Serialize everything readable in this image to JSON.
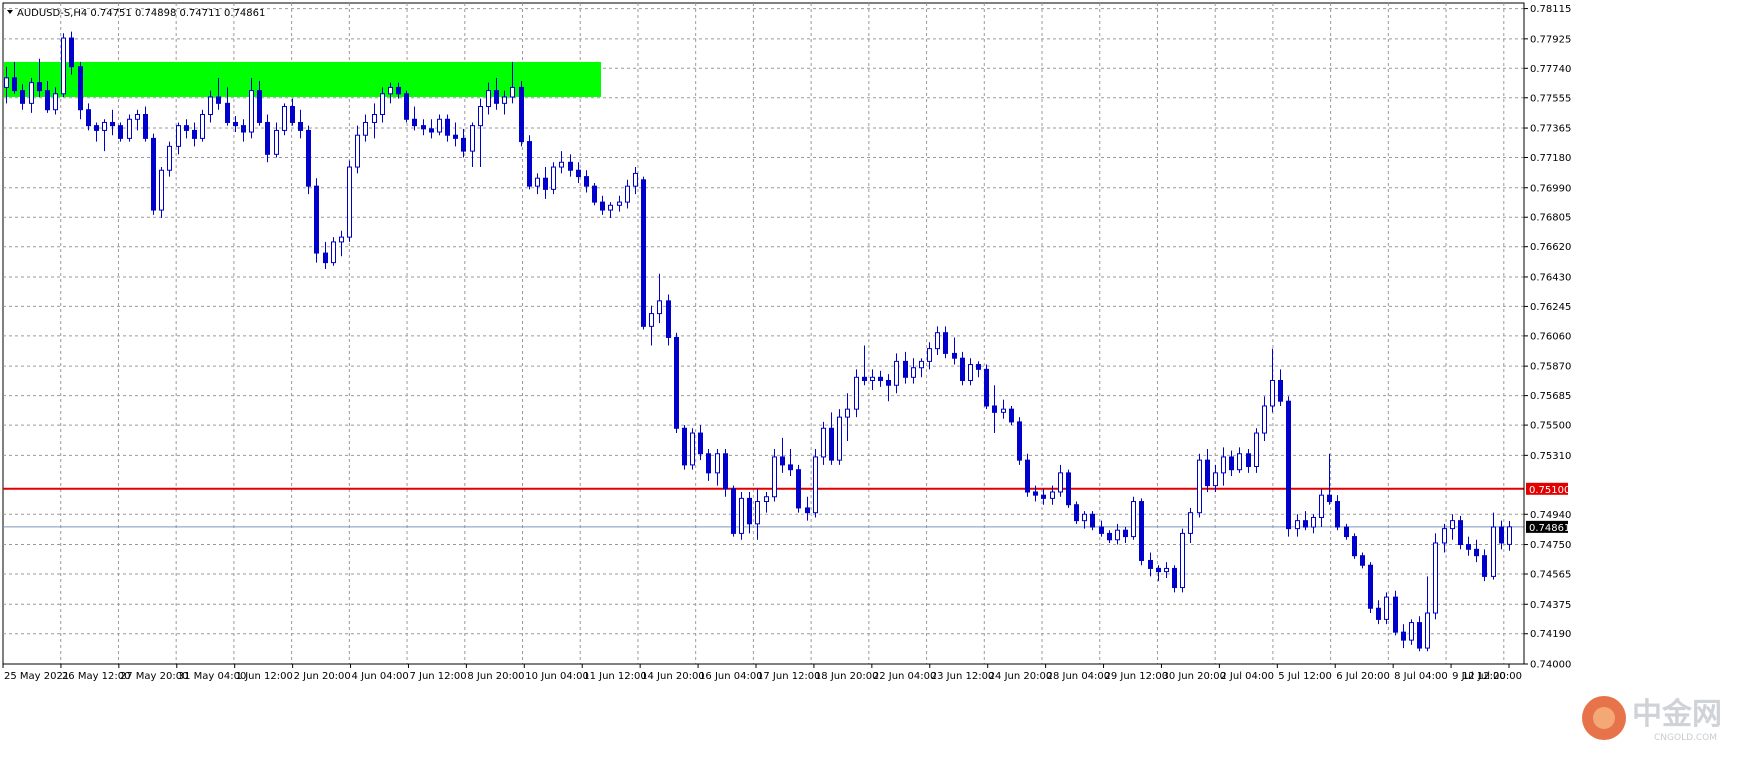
{
  "header": {
    "symbol_text": "AUDUSD-S,H4  0.74751 0.74898 0.74711 0.74861"
  },
  "watermark": {
    "brand_cn": "中金网",
    "brand_en": "CNGOLD.COM"
  },
  "colors": {
    "bull": "#ffffff",
    "bear": "#0000cc",
    "outline": "#0000cc",
    "grid": "#9a9a9a",
    "zone": "#00ff00",
    "resistance_line": "#e00000",
    "current_price_line": "#7a96b8",
    "label_bg": "#000000",
    "label_fg": "#ffffff"
  },
  "chart_data": {
    "type": "candlestick",
    "symbol": "AUDUSD-S",
    "timeframe": "H4",
    "last_bar": {
      "open": 0.74751,
      "high": 0.74898,
      "low": 0.74711,
      "close": 0.74861
    },
    "ylim": [
      0.74,
      0.7815
    ],
    "y_ticks": [
      0.78115,
      0.77925,
      0.7774,
      0.77555,
      0.77365,
      0.7718,
      0.7699,
      0.76805,
      0.7662,
      0.7643,
      0.76245,
      0.7606,
      0.7587,
      0.75685,
      0.755,
      0.7531,
      0.7494,
      0.7475,
      0.74565,
      0.74375,
      0.7419,
      0.74
    ],
    "y_tick_labels": [
      "0.78115",
      "0.77925",
      "0.77740",
      "0.77555",
      "0.77365",
      "0.77180",
      "0.76990",
      "0.76805",
      "0.76620",
      "0.76430",
      "0.76245",
      "0.76060",
      "0.75870",
      "0.75685",
      "0.75500",
      "0.75310",
      "0.74940",
      "0.74750",
      "0.74565",
      "0.74375",
      "0.74190",
      "0.74000"
    ],
    "x_labels": [
      "25 May 2021",
      "26 May 12:00",
      "27 May 20:00",
      "31 May 04:00",
      "1 Jun 12:00",
      "2 Jun 20:00",
      "4 Jun 04:00",
      "7 Jun 12:00",
      "8 Jun 20:00",
      "10 Jun 04:00",
      "11 Jun 12:00",
      "14 Jun 20:00",
      "16 Jun 04:00",
      "17 Jun 12:00",
      "18 Jun 20:00",
      "22 Jun 04:00",
      "23 Jun 12:00",
      "24 Jun 20:00",
      "28 Jun 04:00",
      "29 Jun 12:00",
      "30 Jun 20:00",
      "2 Jul 04:00",
      "5 Jul 12:00",
      "6 Jul 20:00",
      "8 Jul 04:00",
      "9 Jul 12:00",
      "12 Jul 20:00"
    ],
    "resistance_level": {
      "price": 0.751,
      "label": "0.75100"
    },
    "current_price": {
      "price": 0.74861,
      "label": "0.74861"
    },
    "supply_zone": {
      "price_top": 0.7778,
      "price_bottom": 0.7756
    },
    "grid": true,
    "candles": [
      [
        0.7762,
        0.7775,
        0.7752,
        0.7768
      ],
      [
        0.7768,
        0.7778,
        0.7758,
        0.776
      ],
      [
        0.776,
        0.7764,
        0.7748,
        0.7752
      ],
      [
        0.7752,
        0.7768,
        0.7746,
        0.7765
      ],
      [
        0.7765,
        0.778,
        0.7756,
        0.776
      ],
      [
        0.776,
        0.7766,
        0.7746,
        0.7748
      ],
      [
        0.7748,
        0.7762,
        0.7745,
        0.7758
      ],
      [
        0.7758,
        0.7796,
        0.7756,
        0.7793
      ],
      [
        0.7793,
        0.7797,
        0.777,
        0.7775
      ],
      [
        0.7775,
        0.7778,
        0.7742,
        0.7748
      ],
      [
        0.7748,
        0.7752,
        0.7735,
        0.7738
      ],
      [
        0.7738,
        0.774,
        0.7728,
        0.7735
      ],
      [
        0.7735,
        0.7742,
        0.7722,
        0.774
      ],
      [
        0.774,
        0.7748,
        0.7732,
        0.7738
      ],
      [
        0.7738,
        0.774,
        0.7728,
        0.773
      ],
      [
        0.773,
        0.7745,
        0.7728,
        0.7742
      ],
      [
        0.7742,
        0.7748,
        0.7735,
        0.7745
      ],
      [
        0.7745,
        0.775,
        0.7728,
        0.773
      ],
      [
        0.773,
        0.7733,
        0.7682,
        0.7685
      ],
      [
        0.7685,
        0.7712,
        0.768,
        0.771
      ],
      [
        0.771,
        0.7728,
        0.7706,
        0.7725
      ],
      [
        0.7725,
        0.774,
        0.772,
        0.7738
      ],
      [
        0.7738,
        0.7742,
        0.773,
        0.7735
      ],
      [
        0.7735,
        0.774,
        0.7725,
        0.773
      ],
      [
        0.773,
        0.7748,
        0.7728,
        0.7745
      ],
      [
        0.7745,
        0.776,
        0.774,
        0.7756
      ],
      [
        0.7756,
        0.7768,
        0.7748,
        0.7752
      ],
      [
        0.7752,
        0.7762,
        0.7738,
        0.774
      ],
      [
        0.774,
        0.7744,
        0.7734,
        0.7738
      ],
      [
        0.7738,
        0.7742,
        0.7728,
        0.7734
      ],
      [
        0.7734,
        0.7768,
        0.773,
        0.776
      ],
      [
        0.776,
        0.7766,
        0.7738,
        0.774
      ],
      [
        0.774,
        0.7745,
        0.7715,
        0.772
      ],
      [
        0.772,
        0.774,
        0.7718,
        0.7735
      ],
      [
        0.7735,
        0.7752,
        0.7732,
        0.775
      ],
      [
        0.775,
        0.7755,
        0.7738,
        0.774
      ],
      [
        0.774,
        0.7748,
        0.773,
        0.7735
      ],
      [
        0.7735,
        0.7738,
        0.7695,
        0.77
      ],
      [
        0.77,
        0.7705,
        0.7652,
        0.7658
      ],
      [
        0.7658,
        0.7665,
        0.7648,
        0.7652
      ],
      [
        0.7652,
        0.7668,
        0.765,
        0.7665
      ],
      [
        0.7665,
        0.7672,
        0.7656,
        0.7668
      ],
      [
        0.7668,
        0.7716,
        0.7665,
        0.7712
      ],
      [
        0.7712,
        0.7738,
        0.7708,
        0.7732
      ],
      [
        0.7732,
        0.7745,
        0.7728,
        0.774
      ],
      [
        0.774,
        0.7752,
        0.773,
        0.7745
      ],
      [
        0.7745,
        0.7762,
        0.774,
        0.7758
      ],
      [
        0.7758,
        0.7765,
        0.7752,
        0.7762
      ],
      [
        0.7762,
        0.7765,
        0.7755,
        0.7758
      ],
      [
        0.7758,
        0.776,
        0.774,
        0.7742
      ],
      [
        0.7742,
        0.775,
        0.7735,
        0.7738
      ],
      [
        0.7738,
        0.7742,
        0.7732,
        0.7736
      ],
      [
        0.7736,
        0.7742,
        0.773,
        0.7734
      ],
      [
        0.7734,
        0.7745,
        0.7732,
        0.7742
      ],
      [
        0.7742,
        0.7745,
        0.7728,
        0.7732
      ],
      [
        0.7732,
        0.774,
        0.7725,
        0.773
      ],
      [
        0.773,
        0.7736,
        0.7718,
        0.7722
      ],
      [
        0.7722,
        0.774,
        0.7712,
        0.7738
      ],
      [
        0.7738,
        0.7755,
        0.7712,
        0.775
      ],
      [
        0.775,
        0.7765,
        0.7745,
        0.776
      ],
      [
        0.776,
        0.7768,
        0.7748,
        0.7752
      ],
      [
        0.7752,
        0.776,
        0.7745,
        0.7756
      ],
      [
        0.7756,
        0.7778,
        0.7752,
        0.7762
      ],
      [
        0.7762,
        0.7766,
        0.7725,
        0.7728
      ],
      [
        0.7728,
        0.7732,
        0.7698,
        0.77
      ],
      [
        0.77,
        0.7708,
        0.7695,
        0.7705
      ],
      [
        0.7705,
        0.7712,
        0.7692,
        0.7698
      ],
      [
        0.7698,
        0.7715,
        0.7695,
        0.7712
      ],
      [
        0.7712,
        0.7722,
        0.7708,
        0.7715
      ],
      [
        0.7715,
        0.772,
        0.7706,
        0.771
      ],
      [
        0.771,
        0.7715,
        0.7702,
        0.7706
      ],
      [
        0.7706,
        0.771,
        0.7696,
        0.77
      ],
      [
        0.77,
        0.7702,
        0.7688,
        0.769
      ],
      [
        0.769,
        0.7694,
        0.7682,
        0.7685
      ],
      [
        0.7685,
        0.769,
        0.768,
        0.7688
      ],
      [
        0.7688,
        0.7694,
        0.7684,
        0.769
      ],
      [
        0.769,
        0.7704,
        0.7686,
        0.77
      ],
      [
        0.77,
        0.7712,
        0.7695,
        0.7708
      ],
      [
        0.7704,
        0.7706,
        0.761,
        0.7612
      ],
      [
        0.7612,
        0.7625,
        0.76,
        0.762
      ],
      [
        0.762,
        0.7645,
        0.7614,
        0.7628
      ],
      [
        0.7628,
        0.7632,
        0.76,
        0.7605
      ],
      [
        0.7605,
        0.7608,
        0.7545,
        0.7548
      ],
      [
        0.7548,
        0.755,
        0.7522,
        0.7525
      ],
      [
        0.7525,
        0.7548,
        0.7522,
        0.7545
      ],
      [
        0.7545,
        0.755,
        0.7528,
        0.7532
      ],
      [
        0.7532,
        0.7535,
        0.7515,
        0.752
      ],
      [
        0.752,
        0.7535,
        0.7512,
        0.7532
      ],
      [
        0.7532,
        0.7535,
        0.7505,
        0.751
      ],
      [
        0.751,
        0.7512,
        0.748,
        0.7482
      ],
      [
        0.7482,
        0.7508,
        0.7478,
        0.7504
      ],
      [
        0.7504,
        0.7508,
        0.7482,
        0.7488
      ],
      [
        0.7488,
        0.751,
        0.7478,
        0.7502
      ],
      [
        0.7502,
        0.7508,
        0.7495,
        0.7505
      ],
      [
        0.7505,
        0.7535,
        0.7502,
        0.753
      ],
      [
        0.753,
        0.7542,
        0.752,
        0.7525
      ],
      [
        0.7525,
        0.7535,
        0.7518,
        0.7522
      ],
      [
        0.7522,
        0.7525,
        0.7495,
        0.7498
      ],
      [
        0.7498,
        0.7505,
        0.749,
        0.7495
      ],
      [
        0.7495,
        0.7535,
        0.7492,
        0.753
      ],
      [
        0.753,
        0.7552,
        0.7525,
        0.7548
      ],
      [
        0.7548,
        0.7558,
        0.7525,
        0.7528
      ],
      [
        0.7528,
        0.756,
        0.7525,
        0.7555
      ],
      [
        0.7555,
        0.757,
        0.754,
        0.756
      ],
      [
        0.756,
        0.7585,
        0.7555,
        0.758
      ],
      [
        0.758,
        0.76,
        0.7575,
        0.7578
      ],
      [
        0.7578,
        0.7585,
        0.7572,
        0.758
      ],
      [
        0.758,
        0.7584,
        0.7574,
        0.7578
      ],
      [
        0.7578,
        0.7582,
        0.7565,
        0.7575
      ],
      [
        0.7575,
        0.7595,
        0.757,
        0.759
      ],
      [
        0.759,
        0.7596,
        0.7576,
        0.758
      ],
      [
        0.758,
        0.7592,
        0.7576,
        0.7586
      ],
      [
        0.7586,
        0.7592,
        0.758,
        0.759
      ],
      [
        0.759,
        0.7602,
        0.7585,
        0.7598
      ],
      [
        0.7598,
        0.7612,
        0.7594,
        0.7608
      ],
      [
        0.7608,
        0.7612,
        0.7592,
        0.7595
      ],
      [
        0.7595,
        0.7605,
        0.7588,
        0.7592
      ],
      [
        0.7592,
        0.7596,
        0.7575,
        0.7578
      ],
      [
        0.7578,
        0.7592,
        0.7575,
        0.7588
      ],
      [
        0.7588,
        0.759,
        0.758,
        0.7585
      ],
      [
        0.7585,
        0.7588,
        0.756,
        0.7562
      ],
      [
        0.7562,
        0.7575,
        0.7545,
        0.7558
      ],
      [
        0.7558,
        0.7566,
        0.7554,
        0.756
      ],
      [
        0.756,
        0.7562,
        0.755,
        0.7552
      ],
      [
        0.7552,
        0.7555,
        0.7525,
        0.7528
      ],
      [
        0.7528,
        0.7532,
        0.7505,
        0.7508
      ],
      [
        0.7508,
        0.7512,
        0.7502,
        0.7506
      ],
      [
        0.7506,
        0.751,
        0.75,
        0.7504
      ],
      [
        0.7504,
        0.7512,
        0.75,
        0.7508
      ],
      [
        0.7508,
        0.7525,
        0.7505,
        0.752
      ],
      [
        0.752,
        0.7522,
        0.7498,
        0.75
      ],
      [
        0.75,
        0.7502,
        0.7488,
        0.749
      ],
      [
        0.749,
        0.7496,
        0.7485,
        0.7494
      ],
      [
        0.7494,
        0.7496,
        0.7484,
        0.7486
      ],
      [
        0.7486,
        0.749,
        0.748,
        0.7482
      ],
      [
        0.7482,
        0.7484,
        0.7476,
        0.7478
      ],
      [
        0.7478,
        0.7488,
        0.7475,
        0.7484
      ],
      [
        0.7484,
        0.7486,
        0.7476,
        0.748
      ],
      [
        0.748,
        0.7505,
        0.7478,
        0.7502
      ],
      [
        0.7502,
        0.7504,
        0.7462,
        0.7465
      ],
      [
        0.7465,
        0.747,
        0.7455,
        0.746
      ],
      [
        0.746,
        0.7462,
        0.7452,
        0.7458
      ],
      [
        0.7458,
        0.7464,
        0.7454,
        0.746
      ],
      [
        0.746,
        0.7462,
        0.7445,
        0.7448
      ],
      [
        0.7448,
        0.7485,
        0.7445,
        0.7482
      ],
      [
        0.7482,
        0.7498,
        0.7476,
        0.7495
      ],
      [
        0.7495,
        0.7532,
        0.7492,
        0.7528
      ],
      [
        0.7528,
        0.7535,
        0.7508,
        0.7512
      ],
      [
        0.7512,
        0.7525,
        0.7508,
        0.752
      ],
      [
        0.752,
        0.7536,
        0.7512,
        0.753
      ],
      [
        0.753,
        0.7534,
        0.7518,
        0.7522
      ],
      [
        0.7522,
        0.7536,
        0.752,
        0.7532
      ],
      [
        0.7532,
        0.7535,
        0.752,
        0.7524
      ],
      [
        0.7524,
        0.7548,
        0.752,
        0.7545
      ],
      [
        0.7545,
        0.7568,
        0.754,
        0.7562
      ],
      [
        0.7562,
        0.7598,
        0.7558,
        0.7578
      ],
      [
        0.7578,
        0.7585,
        0.7562,
        0.7565
      ],
      [
        0.7565,
        0.7568,
        0.748,
        0.7485
      ],
      [
        0.7485,
        0.7494,
        0.748,
        0.749
      ],
      [
        0.749,
        0.7496,
        0.7484,
        0.7486
      ],
      [
        0.7486,
        0.7494,
        0.7482,
        0.7492
      ],
      [
        0.7492,
        0.751,
        0.7486,
        0.7506
      ],
      [
        0.7506,
        0.7532,
        0.75,
        0.7502
      ],
      [
        0.7502,
        0.7506,
        0.7484,
        0.7486
      ],
      [
        0.7486,
        0.7488,
        0.7478,
        0.748
      ],
      [
        0.748,
        0.7482,
        0.7466,
        0.7468
      ],
      [
        0.7468,
        0.747,
        0.746,
        0.7462
      ],
      [
        0.7462,
        0.7464,
        0.7432,
        0.7435
      ],
      [
        0.7435,
        0.744,
        0.7425,
        0.7428
      ],
      [
        0.7428,
        0.7445,
        0.7425,
        0.7442
      ],
      [
        0.7442,
        0.7446,
        0.7418,
        0.742
      ],
      [
        0.742,
        0.7425,
        0.741,
        0.7415
      ],
      [
        0.7415,
        0.7428,
        0.7412,
        0.7426
      ],
      [
        0.7426,
        0.743,
        0.7408,
        0.741
      ],
      [
        0.741,
        0.7455,
        0.7408,
        0.7432
      ],
      [
        0.7432,
        0.7482,
        0.7428,
        0.7476
      ],
      [
        0.7476,
        0.7488,
        0.747,
        0.7485
      ],
      [
        0.7485,
        0.7494,
        0.7478,
        0.749
      ],
      [
        0.749,
        0.7493,
        0.7472,
        0.7475
      ],
      [
        0.7475,
        0.748,
        0.7468,
        0.7472
      ],
      [
        0.7472,
        0.7478,
        0.7464,
        0.7468
      ],
      [
        0.7468,
        0.7472,
        0.7452,
        0.7455
      ],
      [
        0.7455,
        0.7495,
        0.7453,
        0.7486
      ],
      [
        0.7486,
        0.749,
        0.7472,
        0.7476
      ],
      [
        0.74751,
        0.74898,
        0.74711,
        0.74861
      ]
    ]
  }
}
